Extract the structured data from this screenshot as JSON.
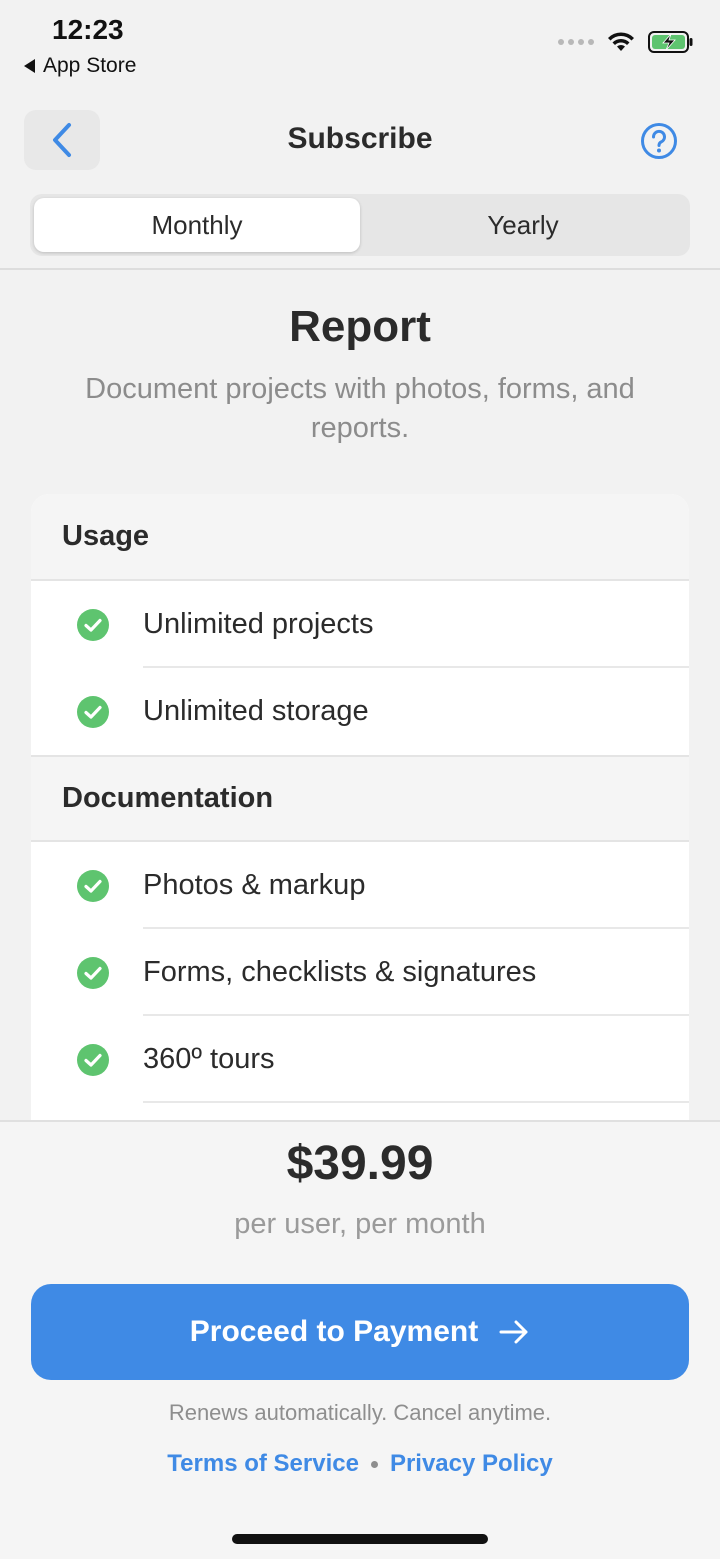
{
  "status_bar": {
    "time": "12:23",
    "back_app": "App Store",
    "icons": [
      "signal-dots-icon",
      "wifi-icon",
      "battery-charging-icon"
    ]
  },
  "nav": {
    "title": "Subscribe",
    "back_icon": "chevron-left-icon",
    "help_icon": "question-circle-icon"
  },
  "billing_toggle": {
    "options": [
      "Monthly",
      "Yearly"
    ],
    "selected": "Monthly"
  },
  "plan": {
    "name": "Report",
    "description": "Document projects with photos, forms, and reports."
  },
  "feature_sections": [
    {
      "header": "Usage",
      "items": [
        "Unlimited projects",
        "Unlimited storage"
      ]
    },
    {
      "header": "Documentation",
      "items": [
        "Photos & markup",
        "Forms, checklists & signatures",
        "360º tours"
      ]
    }
  ],
  "pricing": {
    "price": "$39.99",
    "period": "per user, per month"
  },
  "cta": {
    "label": "Proceed to Payment",
    "icon": "arrow-right-icon"
  },
  "footer": {
    "renew_note": "Renews automatically. Cancel anytime.",
    "terms_label": "Terms of Service",
    "privacy_label": "Privacy Policy"
  },
  "colors": {
    "accent": "#3f8ae5",
    "check": "#5ec46f",
    "background": "#f2f2f2"
  }
}
